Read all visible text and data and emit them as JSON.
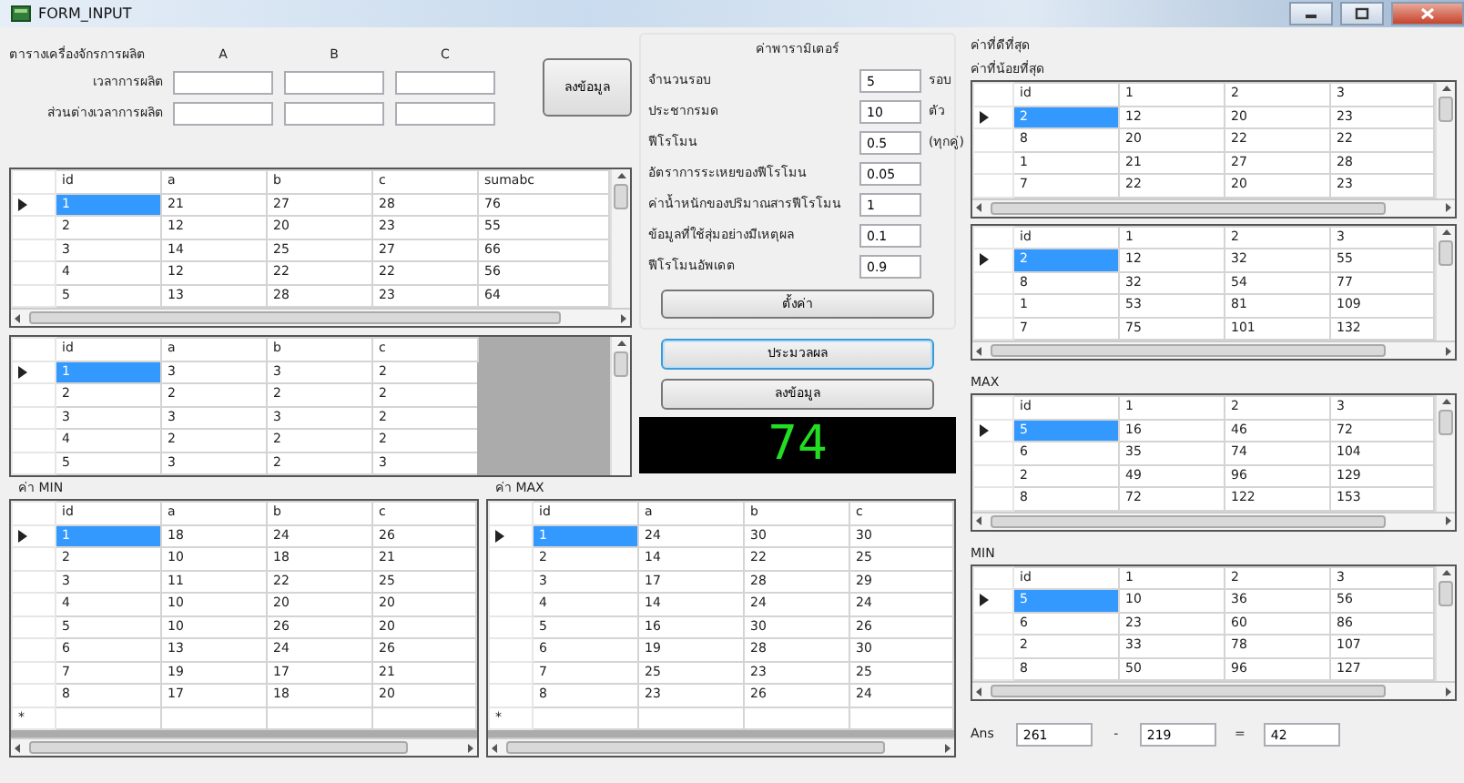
{
  "window": {
    "title": "FORM_INPUT"
  },
  "production": {
    "heading": "ตารางเครื่องจักรการผลิต",
    "columns": [
      "A",
      "B",
      "C"
    ],
    "rows": [
      {
        "label": "เวลาการผลิต"
      },
      {
        "label": "ส่วนต่างเวลาการผลิต"
      }
    ],
    "button": "ลงข้อมูล"
  },
  "main_grid": {
    "columns": [
      "id",
      "a",
      "b",
      "c",
      "sumabc"
    ],
    "rows": [
      {
        "cells": [
          "1",
          "21",
          "27",
          "28",
          "76"
        ],
        "selected": true
      },
      {
        "cells": [
          "2",
          "12",
          "20",
          "23",
          "55"
        ],
        "selected": false
      },
      {
        "cells": [
          "3",
          "14",
          "25",
          "27",
          "66"
        ],
        "selected": false
      },
      {
        "cells": [
          "4",
          "12",
          "22",
          "22",
          "56"
        ],
        "selected": false
      },
      {
        "cells": [
          "5",
          "13",
          "28",
          "23",
          "64"
        ],
        "selected": false
      }
    ]
  },
  "second_grid": {
    "columns": [
      "id",
      "a",
      "b",
      "c"
    ],
    "rows": [
      {
        "cells": [
          "1",
          "3",
          "3",
          "2"
        ],
        "selected": true
      },
      {
        "cells": [
          "2",
          "2",
          "2",
          "2"
        ],
        "selected": false
      },
      {
        "cells": [
          "3",
          "3",
          "3",
          "2"
        ],
        "selected": false
      },
      {
        "cells": [
          "4",
          "2",
          "2",
          "2"
        ],
        "selected": false
      },
      {
        "cells": [
          "5",
          "3",
          "2",
          "3"
        ],
        "selected": false
      }
    ]
  },
  "parameters": {
    "title": "ค่าพารามิเตอร์",
    "fields": [
      {
        "label": "จำนวนรอบ",
        "value": "5",
        "unit": "รอบ"
      },
      {
        "label": "ประชากรมด",
        "value": "10",
        "unit": "ตัว"
      },
      {
        "label": "ฟีโรโมน",
        "value": "0.5",
        "unit": "(ทุกคู่)"
      },
      {
        "label": "อัตราการระเหยของฟีโรโมน",
        "value": "0.05"
      },
      {
        "label": "ค่าน้ำหนักของปริมาณสารฟีโรโมน",
        "value": "1"
      },
      {
        "label": "ข้อมูลที่ใช้สุ่มอย่างมีเหตุผล",
        "value": "0.1"
      },
      {
        "label": "ฟีโรโมนอัพเดต",
        "value": "0.9"
      }
    ],
    "button": "ตั้งค่า"
  },
  "process_button": {
    "label": "ประมวลผล",
    "focused": true
  },
  "save_button": {
    "label": "ลงข้อมูล",
    "focused": false
  },
  "display": "74",
  "min_grid": {
    "label": "ค่า MIN",
    "new_row": "*",
    "columns": [
      "id",
      "a",
      "b",
      "c"
    ],
    "rows": [
      {
        "cells": [
          "1",
          "18",
          "24",
          "26"
        ],
        "selected": true
      },
      {
        "cells": [
          "2",
          "10",
          "18",
          "21"
        ],
        "selected": false
      },
      {
        "cells": [
          "3",
          "11",
          "22",
          "25"
        ],
        "selected": false
      },
      {
        "cells": [
          "4",
          "10",
          "20",
          "20"
        ],
        "selected": false
      },
      {
        "cells": [
          "5",
          "10",
          "26",
          "20"
        ],
        "selected": false
      },
      {
        "cells": [
          "6",
          "13",
          "24",
          "26"
        ],
        "selected": false
      },
      {
        "cells": [
          "7",
          "19",
          "17",
          "21"
        ],
        "selected": false
      },
      {
        "cells": [
          "8",
          "17",
          "18",
          "20"
        ],
        "selected": false
      }
    ]
  },
  "max_grid": {
    "label": "ค่า MAX",
    "new_row": "*",
    "columns": [
      "id",
      "a",
      "b",
      "c"
    ],
    "rows": [
      {
        "cells": [
          "1",
          "24",
          "30",
          "30"
        ],
        "selected": true
      },
      {
        "cells": [
          "2",
          "14",
          "22",
          "25"
        ],
        "selected": false
      },
      {
        "cells": [
          "3",
          "17",
          "28",
          "29"
        ],
        "selected": false
      },
      {
        "cells": [
          "4",
          "14",
          "24",
          "24"
        ],
        "selected": false
      },
      {
        "cells": [
          "5",
          "16",
          "30",
          "26"
        ],
        "selected": false
      },
      {
        "cells": [
          "6",
          "19",
          "28",
          "30"
        ],
        "selected": false
      },
      {
        "cells": [
          "7",
          "25",
          "23",
          "25"
        ],
        "selected": false
      },
      {
        "cells": [
          "8",
          "23",
          "26",
          "24"
        ],
        "selected": false
      }
    ]
  },
  "best": {
    "title": "ค่าที่ดีที่สุด",
    "grids": [
      {
        "label": "ค่าที่น้อยที่สุด",
        "columns": [
          "id",
          "1",
          "2",
          "3"
        ],
        "rows": [
          {
            "cells": [
              "2",
              "12",
              "20",
              "23"
            ],
            "selected": true
          },
          {
            "cells": [
              "8",
              "20",
              "22",
              "22"
            ],
            "selected": false
          },
          {
            "cells": [
              "1",
              "21",
              "27",
              "28"
            ],
            "selected": false
          },
          {
            "cells": [
              "7",
              "22",
              "20",
              "23"
            ],
            "selected": false
          }
        ]
      },
      {
        "columns": [
          "id",
          "1",
          "2",
          "3"
        ],
        "rows": [
          {
            "cells": [
              "2",
              "12",
              "32",
              "55"
            ],
            "selected": true
          },
          {
            "cells": [
              "8",
              "32",
              "54",
              "77"
            ],
            "selected": false
          },
          {
            "cells": [
              "1",
              "53",
              "81",
              "109"
            ],
            "selected": false
          },
          {
            "cells": [
              "7",
              "75",
              "101",
              "132"
            ],
            "selected": false
          }
        ]
      },
      {
        "label": "MAX",
        "columns": [
          "id",
          "1",
          "2",
          "3"
        ],
        "rows": [
          {
            "cells": [
              "5",
              "16",
              "46",
              "72"
            ],
            "selected": true
          },
          {
            "cells": [
              "6",
              "35",
              "74",
              "104"
            ],
            "selected": false
          },
          {
            "cells": [
              "2",
              "49",
              "96",
              "129"
            ],
            "selected": false
          },
          {
            "cells": [
              "8",
              "72",
              "122",
              "153"
            ],
            "selected": false
          }
        ]
      },
      {
        "label": "MIN",
        "columns": [
          "id",
          "1",
          "2",
          "3"
        ],
        "rows": [
          {
            "cells": [
              "5",
              "10",
              "36",
              "56"
            ],
            "selected": true
          },
          {
            "cells": [
              "6",
              "23",
              "60",
              "86"
            ],
            "selected": false
          },
          {
            "cells": [
              "2",
              "33",
              "78",
              "107"
            ],
            "selected": false
          },
          {
            "cells": [
              "8",
              "50",
              "96",
              "127"
            ],
            "selected": false
          }
        ]
      }
    ]
  },
  "answer": {
    "label": "Ans",
    "values": [
      "261",
      "219",
      "42"
    ],
    "operators": [
      "-",
      "="
    ]
  }
}
